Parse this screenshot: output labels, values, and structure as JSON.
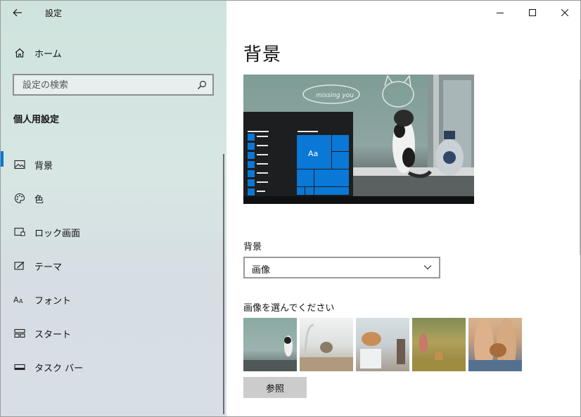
{
  "window": {
    "title": "設定"
  },
  "sidebar": {
    "home_label": "ホーム",
    "search_placeholder": "設定の検索",
    "section_title": "個人用設定",
    "items": [
      {
        "label": "背景",
        "icon": "picture-icon",
        "selected": true
      },
      {
        "label": "色",
        "icon": "palette-icon",
        "selected": false
      },
      {
        "label": "ロック画面",
        "icon": "lock-screen-icon",
        "selected": false
      },
      {
        "label": "テーマ",
        "icon": "theme-icon",
        "selected": false
      },
      {
        "label": "フォント",
        "icon": "font-icon",
        "selected": false
      },
      {
        "label": "スタート",
        "icon": "start-icon",
        "selected": false
      },
      {
        "label": "タスク バー",
        "icon": "taskbar-icon",
        "selected": false
      }
    ]
  },
  "main": {
    "page_title": "背景",
    "preview": {
      "tile_label": "Aa",
      "handwriting": "missing you"
    },
    "background_label": "背景",
    "background_value": "画像",
    "choose_label": "画像を選んでください",
    "browse_label": "参照",
    "thumbnails": [
      "kitten-window",
      "kitten-sink",
      "kitten-basket",
      "girl-kitten-field",
      "kitten-on-legs"
    ]
  },
  "colors": {
    "accent": "#0078d4",
    "tile": "#0a78d6"
  }
}
